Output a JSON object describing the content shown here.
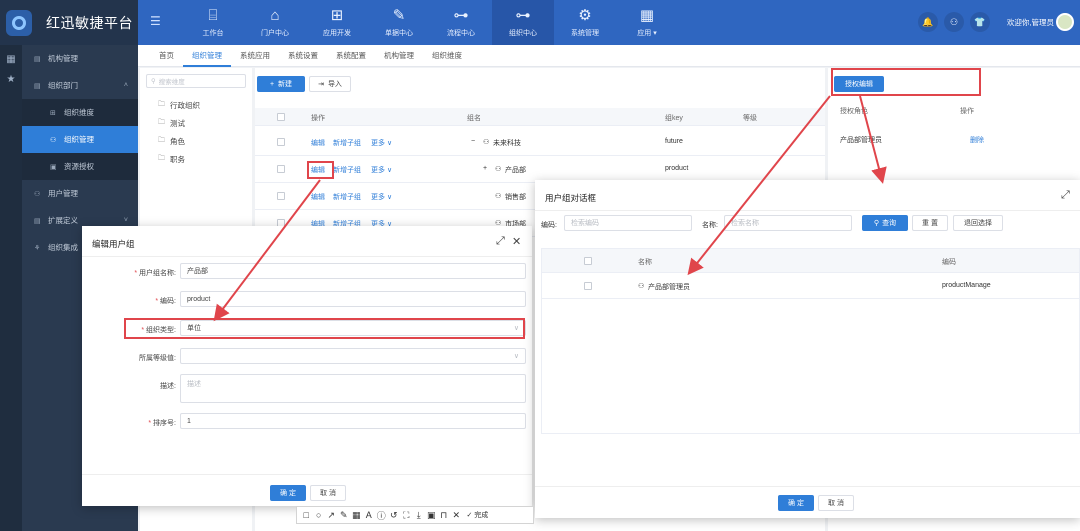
{
  "app": {
    "title": "红迅敏捷平台"
  },
  "rail": {
    "icons": [
      "grid-icon",
      "star-icon"
    ]
  },
  "sidebar": {
    "items": [
      {
        "label": "机构管理",
        "icon": "building-icon"
      },
      {
        "label": "组织部门",
        "icon": "org-icon",
        "expanded": true
      },
      {
        "label": "组织维度",
        "icon": "dimension-icon",
        "sub": true
      },
      {
        "label": "组织管理",
        "icon": "group-icon",
        "sub": true,
        "active": true
      },
      {
        "label": "资源授权",
        "icon": "auth-icon",
        "sub": true
      },
      {
        "label": "用户管理",
        "icon": "user-icon"
      },
      {
        "label": "扩展定义",
        "icon": "extend-icon"
      },
      {
        "label": "组织集成",
        "icon": "integrate-icon"
      }
    ]
  },
  "topnav": {
    "items": [
      {
        "label": "工作台",
        "icon": "chart-icon"
      },
      {
        "label": "门户中心",
        "icon": "home-icon"
      },
      {
        "label": "应用开发",
        "icon": "apps-icon"
      },
      {
        "label": "单据中心",
        "icon": "edit-icon"
      },
      {
        "label": "流程中心",
        "icon": "flow-icon"
      },
      {
        "label": "组织中心",
        "icon": "org-icon",
        "active": true
      },
      {
        "label": "系统管理",
        "icon": "gear-icon"
      },
      {
        "label": "应用 ▾",
        "icon": "apps-icon"
      }
    ],
    "welcome": "欢迎你,管理员"
  },
  "tabs": [
    "首页",
    "组织管理",
    "系统应用",
    "系统设置",
    "系统配置",
    "机构管理",
    "组织维度"
  ],
  "tree": {
    "search_placeholder": "搜索维度",
    "items": [
      "行政组织",
      "测试",
      "角色",
      "职务"
    ]
  },
  "toolbar": {
    "new_label": "新建",
    "import_label": "导入"
  },
  "table": {
    "columns": [
      "操作",
      "组名",
      "组key",
      "等级"
    ],
    "actions": {
      "edit": "编辑",
      "add_child": "新增子组",
      "more": "更多 ∨"
    },
    "rows": [
      {
        "name": "未来科技",
        "key": "future",
        "prefix": "−"
      },
      {
        "name": "产品部",
        "key": "product",
        "prefix": "+"
      },
      {
        "name": "销售部",
        "key": "",
        "prefix": ""
      },
      {
        "name": "市场部",
        "key": "",
        "prefix": ""
      }
    ]
  },
  "auth_panel": {
    "button": "授权编辑",
    "columns": [
      "授权角色",
      "操作"
    ],
    "row": {
      "role": "产品部管理员",
      "action": "删除"
    }
  },
  "edit_dialog": {
    "title": "编辑用户组",
    "fields": {
      "name_label": "用户组名称:",
      "name_value": "产品部",
      "code_label": "编码:",
      "code_value": "product",
      "type_label": "组织类型:",
      "type_value": "单位",
      "level_label": "所属等级值:",
      "desc_label": "描述:",
      "desc_placeholder": "描述",
      "sort_label": "排序号:",
      "sort_value": "1"
    },
    "ok": "确 定",
    "cancel": "取 消"
  },
  "picker_dialog": {
    "title": "用户组对话框",
    "code_label": "编码:",
    "code_placeholder": "检索编码",
    "name_label": "名称:",
    "name_placeholder": "检索名称",
    "search": "查询",
    "reset": "重 置",
    "clear": "退回选择",
    "columns": [
      "名称",
      "编码"
    ],
    "row": {
      "name": "产品部管理员",
      "code": "productManage"
    },
    "ok": "确 定",
    "cancel": "取 消"
  },
  "snip_toolbar": {
    "icons": [
      "□",
      "○",
      "↗",
      "✎",
      "▦",
      "A",
      "ⓘ",
      "↺",
      "⛶",
      "⤓",
      "▣",
      "⊓"
    ],
    "close": "✕",
    "done": "✓ 完成"
  },
  "colors": {
    "primary": "#2f7ed8",
    "header": "#2f66c0",
    "sidebar": "#2a3a50",
    "highlight": "#e0454b"
  }
}
